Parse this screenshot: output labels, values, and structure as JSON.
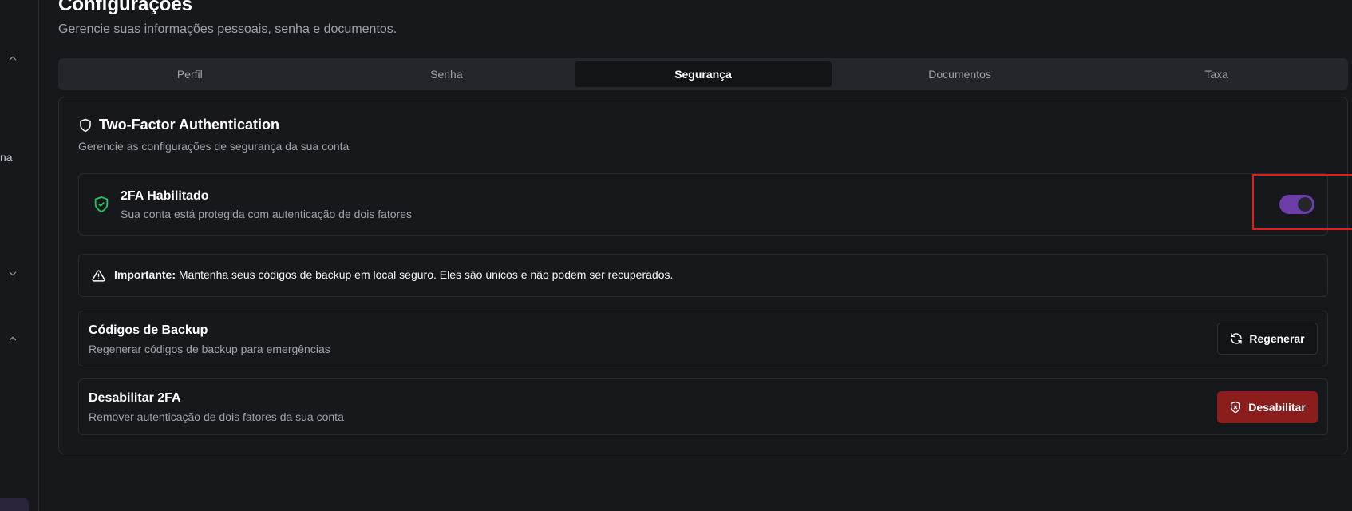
{
  "sidebar": {
    "partial_label": "na",
    "icons": [
      "chevron-up-icon",
      "chevron-down-icon",
      "chevron-up-icon"
    ]
  },
  "page": {
    "title": "Configurações",
    "subtitle": "Gerencie suas informações pessoais, senha e documentos."
  },
  "tabs": [
    {
      "label": "Perfil",
      "active": false
    },
    {
      "label": "Senha",
      "active": false
    },
    {
      "label": "Segurança",
      "active": true
    },
    {
      "label": "Documentos",
      "active": false
    },
    {
      "label": "Taxa",
      "active": false
    }
  ],
  "card": {
    "title": "Two-Factor Authentication",
    "subtitle": "Gerencie as configurações de segurança da sua conta",
    "status": {
      "title": "2FA Habilitado",
      "description": "Sua conta está protegida com autenticação de dois fatores",
      "enabled": true
    },
    "alert": {
      "label": "Importante:",
      "text": "Mantenha seus códigos de backup em local seguro. Eles são únicos e não podem ser recuperados."
    },
    "backup": {
      "title": "Códigos de Backup",
      "description": "Regenerar códigos de backup para emergências",
      "button_label": "Regenerar"
    },
    "disable": {
      "title": "Desabilitar 2FA",
      "description": "Remover autenticação de dois fatores da sua conta",
      "button_label": "Desabilitar"
    }
  },
  "colors": {
    "accent": "#6c3fa8",
    "success": "#22c55e",
    "danger": "#8b1d1d",
    "highlight": "#e21b1b"
  }
}
